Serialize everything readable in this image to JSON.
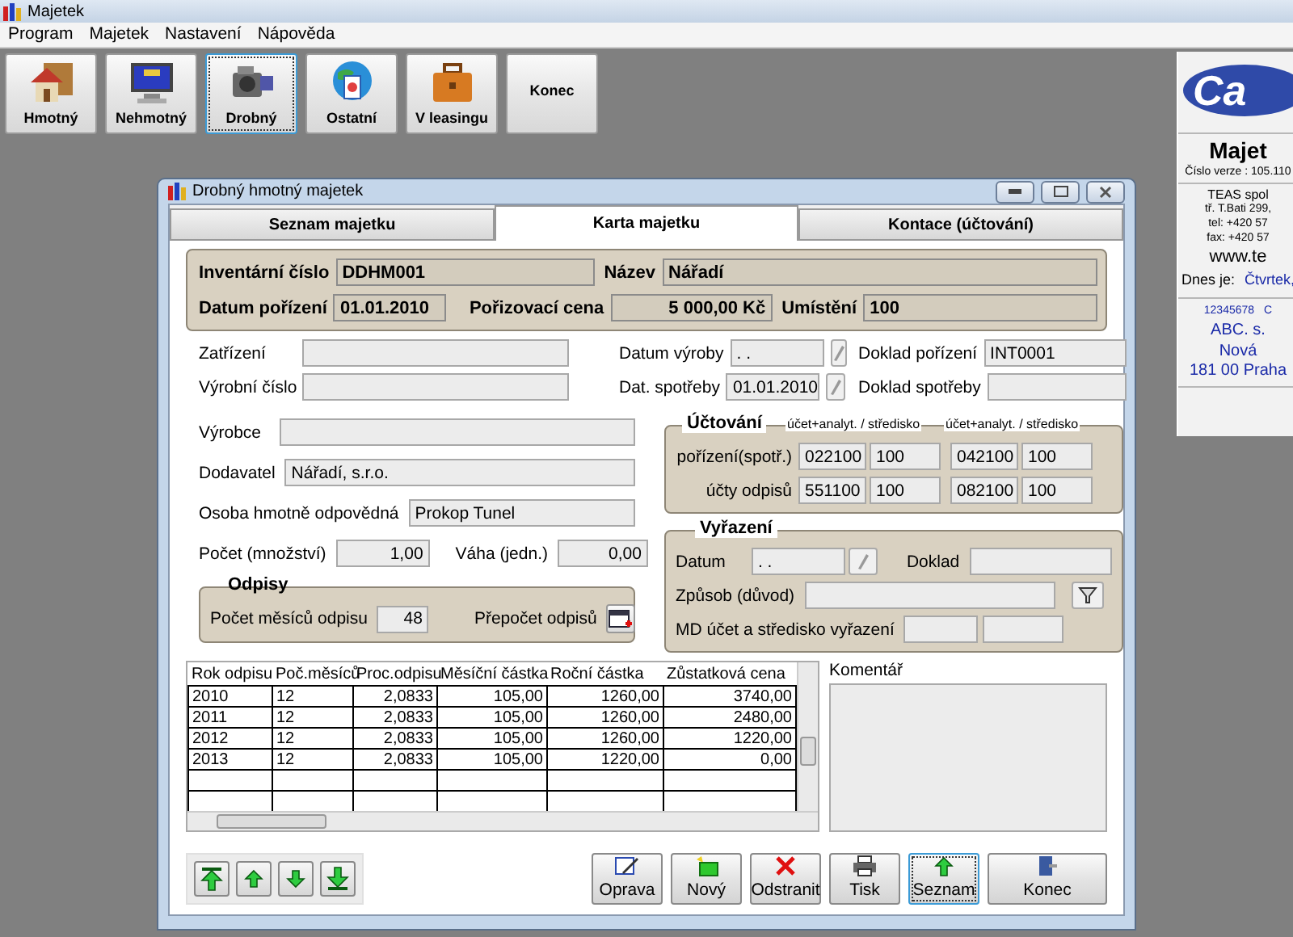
{
  "app": {
    "title": "Majetek"
  },
  "menu": [
    "Program",
    "Majetek",
    "Nastavení",
    "Nápověda"
  ],
  "toolbar": [
    {
      "label": "Hmotný",
      "kind": "house",
      "selected": false
    },
    {
      "label": "Nehmotný",
      "kind": "monitor",
      "selected": false
    },
    {
      "label": "Drobný",
      "kind": "camera",
      "selected": true
    },
    {
      "label": "Ostatní",
      "kind": "globe",
      "selected": false
    },
    {
      "label": "V leasingu",
      "kind": "briefcase",
      "selected": false
    },
    {
      "label": "Konec",
      "kind": "text",
      "selected": false
    }
  ],
  "info_panel": {
    "logo": "Ca",
    "title": "Majet",
    "version": "Číslo verze : 105.110",
    "company": [
      "TEAS spol",
      "tř. T.Bati 299,",
      "tel: +420 57",
      "fax: +420 57"
    ],
    "web": "www.te",
    "today_label": "Dnes je:",
    "today": "Čtvrtek,",
    "licence": [
      "12345678",
      "C"
    ],
    "customer": [
      "ABC. s.",
      "Nová",
      "181 00  Praha"
    ]
  },
  "dialog": {
    "title": "Drobný hmotný majetek",
    "tabs": [
      {
        "label": "Seznam majetku",
        "selected": false
      },
      {
        "label": "Karta majetku",
        "selected": true
      },
      {
        "label": "Kontace (účtování)",
        "selected": false
      }
    ],
    "header": [
      {
        "label": "Inventární číslo",
        "value": "DDHM001"
      },
      {
        "label": "Název",
        "value": "Nářadí"
      },
      {
        "label": "Datum pořízení",
        "value": "01.01.2010"
      },
      {
        "label": "Pořizovací cena",
        "value": "5 000,00 Kč"
      },
      {
        "label": "Umístění",
        "value": "100"
      }
    ],
    "top_rows": [
      [
        {
          "label": "Zatřízení"
        },
        {
          "label": "Datum výroby",
          "value": ".  .",
          "kind": "date"
        },
        {
          "label": "Doklad pořízení",
          "value": "INT0001"
        }
      ],
      [
        {
          "label": "Výrobní číslo"
        },
        {
          "label": "Dat. spotřeby",
          "value": "01.01.2010",
          "kind": "date"
        },
        {
          "label": "Doklad spotřeby"
        }
      ]
    ],
    "left_fields": [
      {
        "label": "Výrobce"
      },
      {
        "label": "Dodavatel",
        "value": "Nářadí, s.r.o."
      },
      {
        "label": "Osoba hmotně odpovědná",
        "value": "Prokop Tunel"
      }
    ],
    "quantity": {
      "label": "Počet (množství)",
      "value": "1,00"
    },
    "weight": {
      "label": "Váha (jedn.)",
      "value": "0,00"
    },
    "odpisy": {
      "title": "Odpisy",
      "months_label": "Počet měsíců odpisu",
      "months": "48",
      "recalc_label": "Přepočet odpisů"
    },
    "uctovani": {
      "title": "Účtování",
      "column_headers": [
        "účet+analyt. / středisko",
        "účet+analyt. / středisko"
      ],
      "rows": [
        {
          "label": "pořízení(spotř.)",
          "values": [
            "022100",
            "100",
            "042100",
            "100"
          ]
        },
        {
          "label": "účty odpisů",
          "values": [
            "551100",
            "100",
            "082100",
            "100"
          ]
        }
      ]
    },
    "vyrazeni": {
      "title": "Vyřazení",
      "date_label": "Datum",
      "date": ".  .",
      "doc_label": "Doklad",
      "reason_label": "Způsob (důvod)",
      "md_label": "MD účet  a středisko vyřazení"
    },
    "table": {
      "columns": [
        "Rok odpisu",
        "Poč.měsíců",
        "Proc.odpisu",
        "Měsíční částka",
        "Roční částka",
        "Zůstatková cena"
      ],
      "rows": [
        [
          "2010",
          "12",
          "2,0833",
          "105,00",
          "1260,00",
          "3740,00"
        ],
        [
          "2011",
          "12",
          "2,0833",
          "105,00",
          "1260,00",
          "2480,00"
        ],
        [
          "2012",
          "12",
          "2,0833",
          "105,00",
          "1260,00",
          "1220,00"
        ],
        [
          "2013",
          "12",
          "2,0833",
          "105,00",
          "1220,00",
          "0,00"
        ]
      ]
    },
    "comment": {
      "label": "Komentář"
    },
    "nav_buttons": [
      {
        "kind": "first"
      },
      {
        "kind": "up"
      },
      {
        "kind": "down"
      },
      {
        "kind": "last"
      }
    ],
    "actions": [
      {
        "label": "Oprava",
        "kind": "edit",
        "selected": false
      },
      {
        "label": "Nový",
        "kind": "new",
        "selected": false
      },
      {
        "label": "Odstranit",
        "kind": "delete",
        "selected": false
      },
      {
        "label": "Tisk",
        "kind": "print",
        "selected": false
      },
      {
        "label": "Seznam",
        "kind": "list",
        "selected": true
      },
      {
        "label": "Konec",
        "kind": "exit",
        "selected": false
      }
    ]
  }
}
